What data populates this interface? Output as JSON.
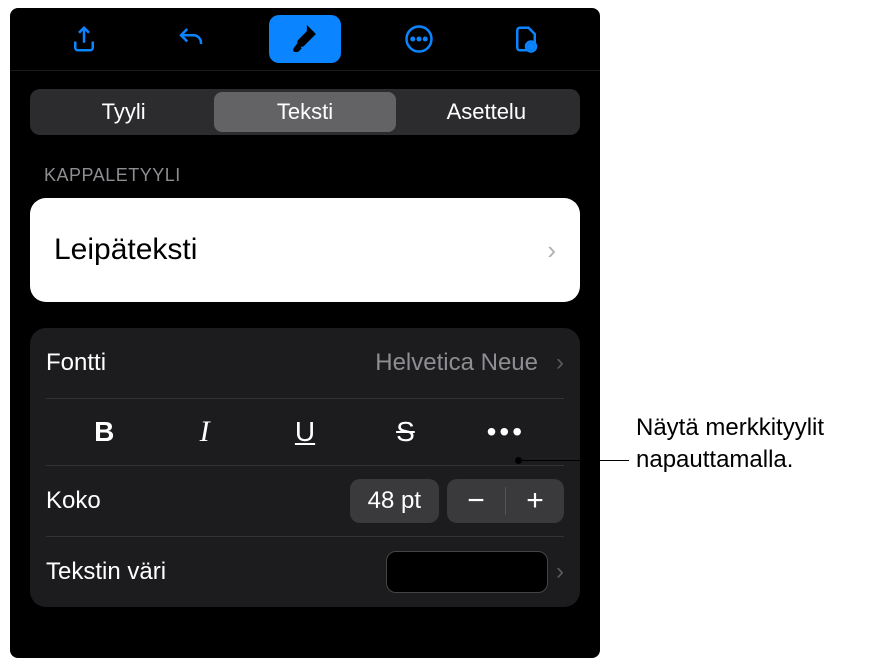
{
  "tabs": {
    "style": "Tyyli",
    "text": "Teksti",
    "layout": "Asettelu"
  },
  "section": {
    "paragraphStyle": "KAPPALETYYLI"
  },
  "paragraphStyle": {
    "current": "Leipäteksti"
  },
  "font": {
    "label": "Fontti",
    "value": "Helvetica Neue"
  },
  "styleButtons": {
    "bold": "B",
    "italic": "I",
    "underline": "U",
    "strike": "S"
  },
  "size": {
    "label": "Koko",
    "value": "48 pt",
    "minus": "−",
    "plus": "+"
  },
  "textColor": {
    "label": "Tekstin väri",
    "value": "#000000"
  },
  "callout": {
    "line1": "Näytä merkkityylit",
    "line2": "napauttamalla."
  }
}
